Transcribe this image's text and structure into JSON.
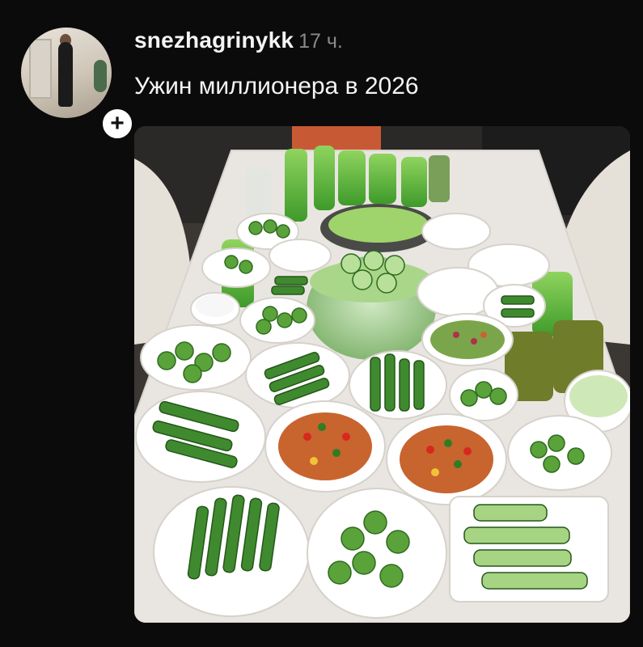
{
  "post": {
    "username": "snezhagrinykk",
    "time": "17 ч.",
    "caption": "Ужин миллионера в 2026",
    "follow_symbol": "+"
  },
  "colors": {
    "background": "#0b0b0b",
    "text": "#f4f4f4",
    "muted": "#8a8a8a",
    "cucumber_green": "#3f8a2e",
    "juice_green": "#6cc04a"
  }
}
